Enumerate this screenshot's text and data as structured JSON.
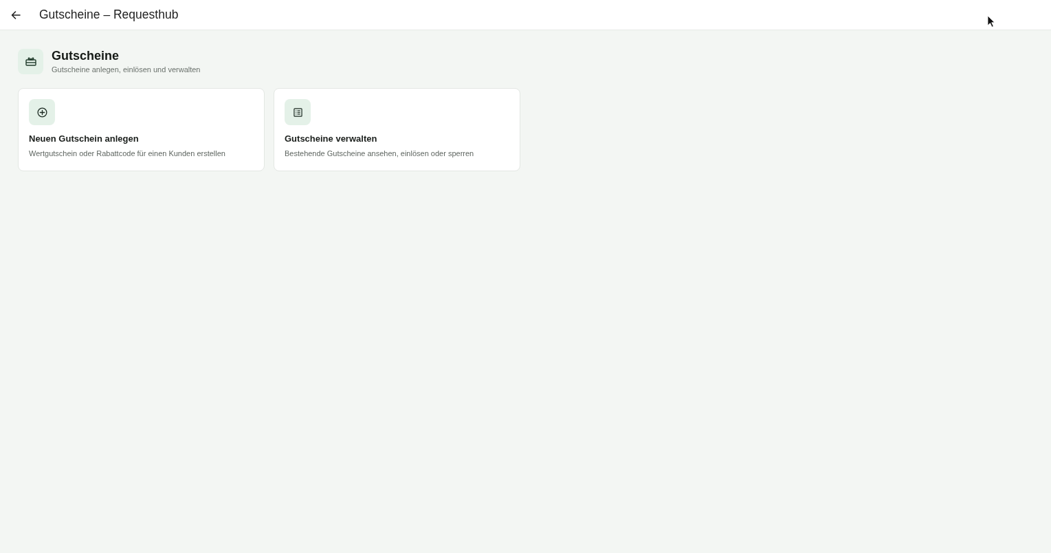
{
  "top_bar": {
    "title": "Gutscheine – Requesthub"
  },
  "page_header": {
    "title": "Gutscheine",
    "subtitle": "Gutscheine anlegen, einlösen und verwalten"
  },
  "cards": [
    {
      "title": "Neuen Gutschein anlegen",
      "description": "Wertgutschein oder Rabattcode für einen Kunden erstellen"
    },
    {
      "title": "Gutscheine verwalten",
      "description": "Bestehende Gutscheine ansehen, einlösen oder sperren"
    }
  ]
}
